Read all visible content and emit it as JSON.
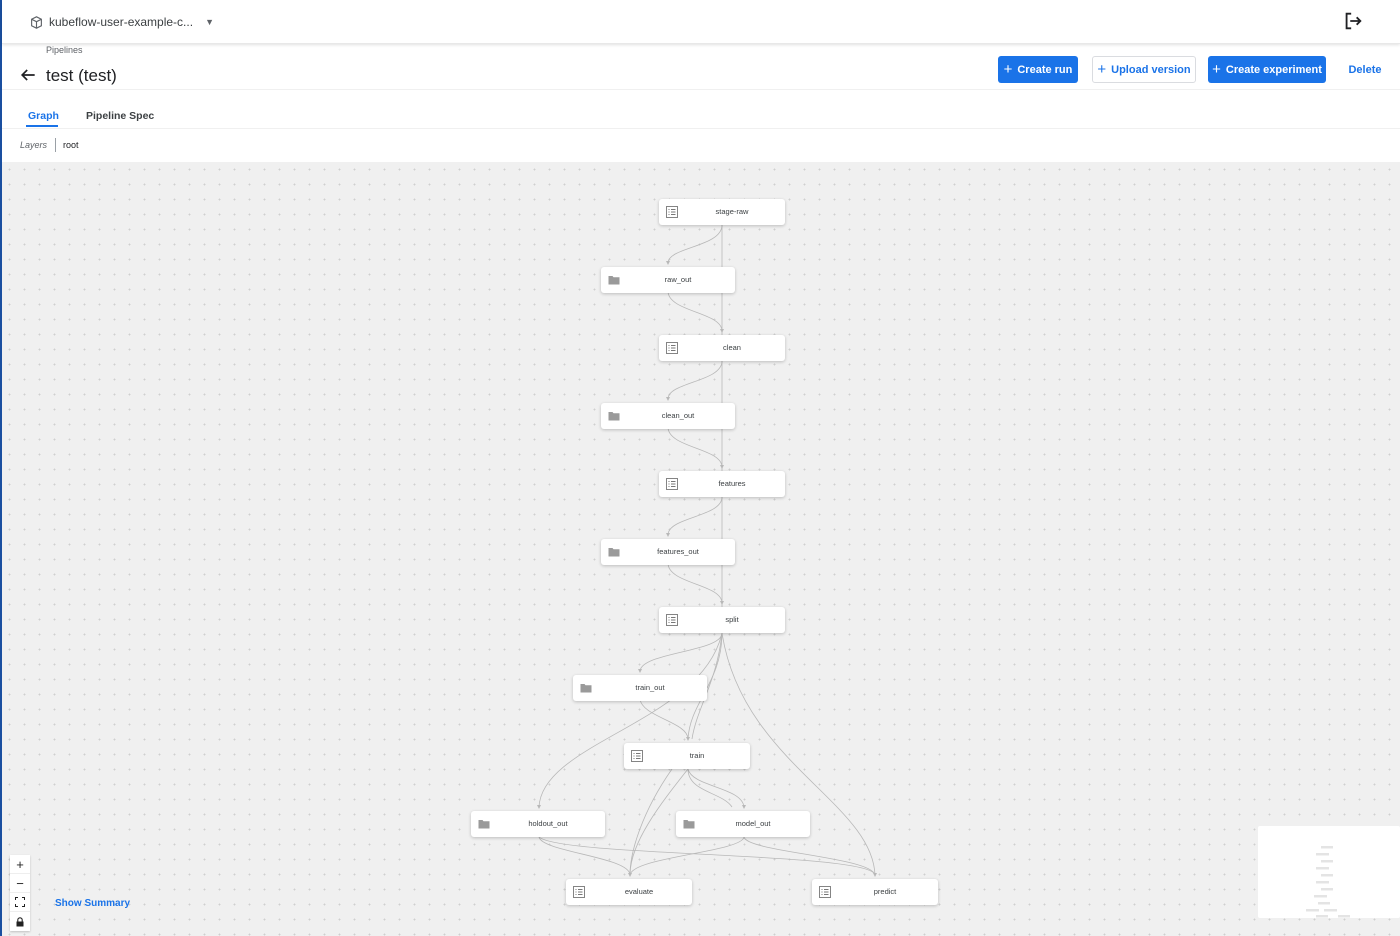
{
  "topbar": {
    "namespace": "kubeflow-user-example-c...",
    "namespace_icon": "box-icon",
    "logout_icon": "logout-icon"
  },
  "header": {
    "breadcrumb": "Pipelines",
    "title": "test (test)"
  },
  "actions": {
    "create_run": "Create run",
    "upload_version": "Upload version",
    "create_experiment": "Create experiment",
    "delete": "Delete"
  },
  "tabs": {
    "graph": "Graph",
    "spec": "Pipeline Spec"
  },
  "layers": {
    "label": "Layers",
    "value": "root"
  },
  "graph": {
    "nodes": {
      "stage_raw": "stage-raw",
      "raw_out": "raw_out",
      "clean": "clean",
      "clean_out": "clean_out",
      "features": "features",
      "features_out": "features_out",
      "split": "split",
      "train_out": "train_out",
      "train": "train",
      "holdout_out": "holdout_out",
      "model_out": "model_out",
      "evaluate": "evaluate",
      "predict": "predict"
    }
  },
  "controls": {
    "zoom_in": "+",
    "zoom_out": "−",
    "fit": "⛶",
    "lock": "🔒",
    "show_summary": "Show Summary"
  },
  "colors": {
    "accent": "#1a73e8",
    "edge": "#b8b8b8",
    "canvas": "#f0f0f0"
  }
}
